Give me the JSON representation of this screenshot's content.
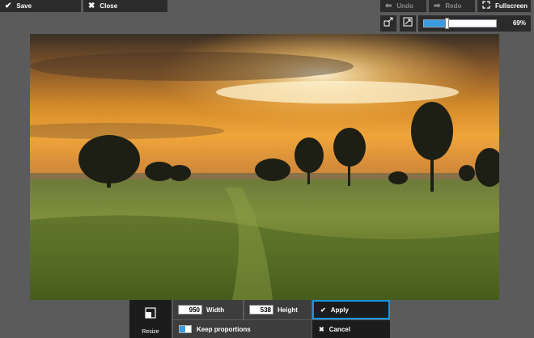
{
  "toolbar": {
    "save_label": "Save",
    "close_label": "Close",
    "undo_label": "Undo",
    "redo_label": "Redo",
    "fullscreen_label": "Fullscreen"
  },
  "zoom": {
    "value_label": "69%",
    "level_fraction": 0.69
  },
  "resize_panel": {
    "tool_label": "Resize",
    "width_value": "950",
    "width_label": "Width",
    "height_value": "538",
    "height_label": "Height",
    "keep_proportions_label": "Keep proportions",
    "keep_proportions_on": true,
    "apply_label": "Apply",
    "cancel_label": "Cancel"
  },
  "colors": {
    "accent": "#1a95e0",
    "background": "#5b5b5b",
    "button": "#2b2b2b"
  }
}
